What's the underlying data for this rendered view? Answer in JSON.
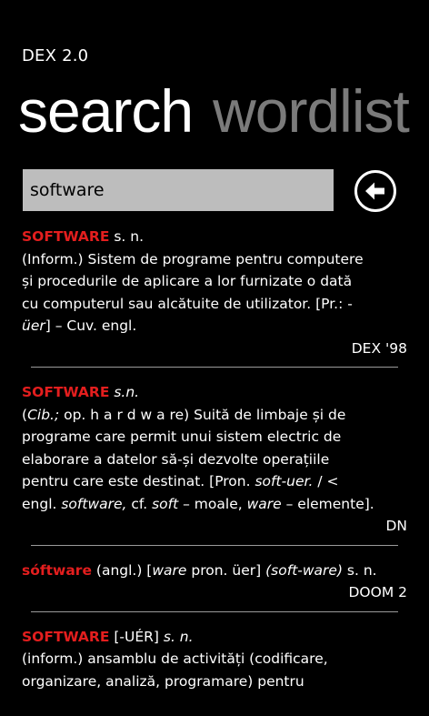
{
  "app": {
    "title": "DEX 2.0"
  },
  "pivot": {
    "active": "search",
    "inactive": "wordlist"
  },
  "search": {
    "value": "software"
  },
  "entries": [
    {
      "headword": "SOFTWARE",
      "pos": " s. n.",
      "line1": "(Inform.) Sistem de programe pentru computere",
      "line2": "și procedurile de aplicare a lor furnizate o dată",
      "line3": "cu computerul sau alcătuite de utilizator. [Pr.: -",
      "line4_italic": "üer",
      "line4_rest": "] – Cuv. engl.",
      "source": "DEX '98"
    },
    {
      "headword": "SOFTWARE",
      "pos": " s.n.",
      "l1_open": "(",
      "l1_cib": "Cib.;",
      "l1_rest": " op. h a r d w a re) Suită de limbaje și de",
      "line2": "programe care permit unui sistem electric de",
      "line3": "elaborare a datelor să-și dezvolte operațiile",
      "l4_a": "pentru care este destinat. [Pron. ",
      "l4_b": "soft-uer.",
      "l4_c": " / <",
      "l5_a": "engl. ",
      "l5_b": "software,",
      "l5_c": " cf. ",
      "l5_d": "soft",
      "l5_e": " – moale, ",
      "l5_f": "ware",
      "l5_g": " – elemente].",
      "source": "DN"
    },
    {
      "headword": "sóftware",
      "t1": " (angl.) [",
      "t2": "ware",
      "t3": " pron. üer] ",
      "t4": "(soft-ware)",
      "t5": " s. n.",
      "source": "DOOM 2"
    },
    {
      "headword": "SOFTWARE",
      "t1": " [-UÉR] ",
      "t2": "s. n.",
      "line1": "(inform.) ansamblu de activități (codificare,",
      "line2": "organizare, analiză, programare) pentru"
    }
  ]
}
